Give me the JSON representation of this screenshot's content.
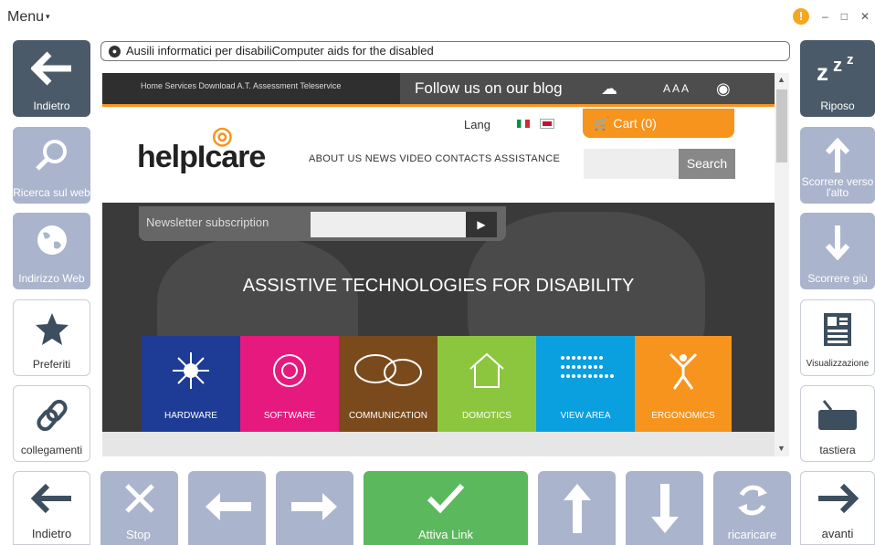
{
  "window": {
    "menu_label": "Menu",
    "warning_icon": "warning-icon"
  },
  "address": {
    "text": "Ausili informatici per disabiliComputer aids for the disabled"
  },
  "left_tiles": [
    {
      "label": "Indietro",
      "icon": "arrow-left-icon"
    },
    {
      "label": "Ricerca sul web",
      "icon": "search-icon"
    },
    {
      "label": "Indirizzo Web",
      "icon": "globe-icon"
    },
    {
      "label": "Preferiti",
      "icon": "star-icon"
    },
    {
      "label": "collegamenti",
      "icon": "link-icon"
    }
  ],
  "right_tiles": [
    {
      "label": "Riposo",
      "icon": "sleep-icon"
    },
    {
      "label": "Scorrere verso l'alto",
      "icon": "arrow-up-icon"
    },
    {
      "label": "Scorrere giù",
      "icon": "arrow-down-icon"
    },
    {
      "label": "Visualizzazione",
      "icon": "view-icon"
    },
    {
      "label": "tastiera",
      "icon": "keyboard-icon"
    }
  ],
  "bottom": {
    "back": "Indietro",
    "stop": "Stop",
    "activate": "Attiva Link",
    "reload": "ricaricare",
    "forward": "avanti"
  },
  "site": {
    "top_nav": "Home Services Download A.T. Assessment Teleservice",
    "follow": "Follow us on our blog",
    "font_sizes": "A A A",
    "lang": "Lang",
    "cart": "Cart (0)",
    "logo": "helpIcare",
    "main_nav": "ABOUT US NEWS VIDEO CONTACTS ASSISTANCE",
    "search_btn": "Search",
    "newsletter": "Newsletter subscription",
    "hero_title": "ASSISTIVE TECHNOLOGIES FOR DISABILITY",
    "categories": [
      {
        "label": "HARDWARE",
        "color": "#1e3c96"
      },
      {
        "label": "SOFTWARE",
        "color": "#e6197f"
      },
      {
        "label": "COMMUNICATION",
        "color": "#7a4a1c"
      },
      {
        "label": "DOMOTICS",
        "color": "#8cc63f"
      },
      {
        "label": "VIEW AREA",
        "color": "#0aa0e0"
      },
      {
        "label": "ERGONOMICS",
        "color": "#f7941d"
      }
    ]
  },
  "colors": {
    "dark_tile": "#4a5a68",
    "light_tile": "#aab4cc",
    "green": "#5cb85c",
    "accent": "#f7941d"
  }
}
